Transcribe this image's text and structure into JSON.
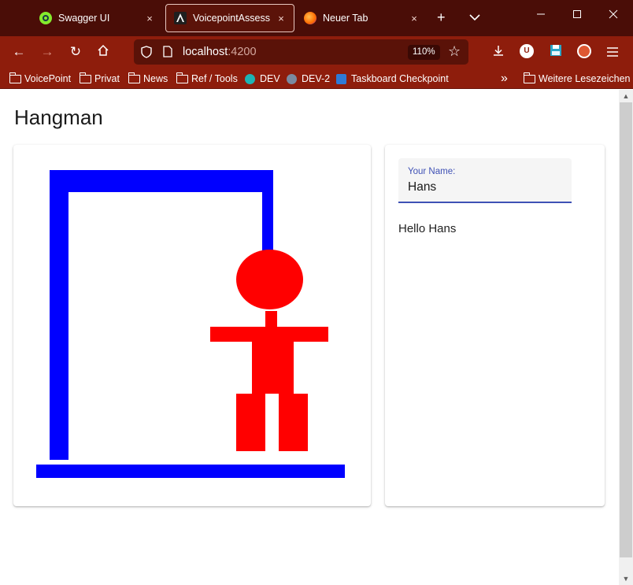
{
  "tabs": [
    {
      "title": "Swagger UI",
      "close": "×",
      "favicon": "swagger-icon"
    },
    {
      "title": "VoicepointAssessment",
      "close": "×",
      "favicon": "angular-icon"
    },
    {
      "title": "Neuer Tab",
      "close": "×",
      "favicon": "firefox-icon"
    }
  ],
  "tabbar": {
    "new_tab": "+",
    "list_tabs": "⌄",
    "minimize": "—",
    "maximize": "☐",
    "close": "✕"
  },
  "toolbar": {
    "back": "←",
    "forward": "→",
    "reload": "↻",
    "home": "⌂",
    "url_host": "localhost",
    "url_port": ":4200",
    "zoom": "110%",
    "bookmark_star": "☆",
    "download": "⭳",
    "menu": "≡",
    "ublock_letter": "U",
    "save_icon": "save-icon",
    "ddg_icon": "duckduckgo-icon"
  },
  "bookmarks": {
    "items": [
      "VoicePoint",
      "Privat",
      "News",
      "Ref / Tools",
      "DEV",
      "DEV-2",
      "Taskboard Checkpoint"
    ],
    "overflow": "»",
    "other": "Weitere Lesezeichen"
  },
  "page": {
    "title": "Hangman",
    "name_label": "Your Name:",
    "name_value": "Hans",
    "greeting": "Hello Hans"
  },
  "colors": {
    "gallows": "#0000ff",
    "figure": "#ff0000",
    "accent": "#3f51b5",
    "tabbar": "#4a0d07",
    "toolbar": "#8e1d0c"
  },
  "scrollbar": {
    "up": "▲",
    "down": "▼"
  }
}
